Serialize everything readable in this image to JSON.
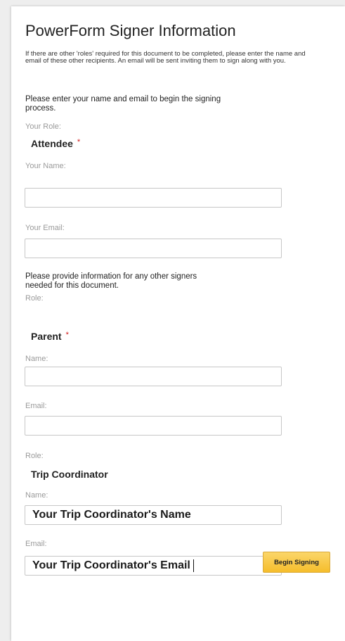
{
  "form": {
    "title": "PowerForm Signer Information",
    "intro": "If there are other 'roles' required for this document to be completed, please enter the name and email of these other recipients. An email will be sent inviting them to sign along with you.",
    "prompt_self": "Please enter your name and email to begin the signing process.",
    "prompt_others": "Please provide information for any other signers needed for this document.",
    "required_marker": "*"
  },
  "you": {
    "role_label": "Your Role:",
    "role": "Attendee",
    "name_label": "Your Name:",
    "name_value": "",
    "email_label": "Your Email:",
    "email_value": ""
  },
  "signer_parent": {
    "role_label": "Role:",
    "role": "Parent",
    "name_label": "Name:",
    "name_value": "",
    "email_label": "Email:",
    "email_value": ""
  },
  "signer_coordinator": {
    "role_label": "Role:",
    "role": "Trip Coordinator",
    "name_label": "Name:",
    "name_value": "Your Trip Coordinator's Name",
    "email_label": "Email:",
    "email_value": "Your Trip Coordinator's Email"
  },
  "actions": {
    "begin_label": "Begin Signing"
  },
  "colors": {
    "button": "#f5bd2b",
    "required": "#d01818",
    "label": "#9a9a9a"
  }
}
